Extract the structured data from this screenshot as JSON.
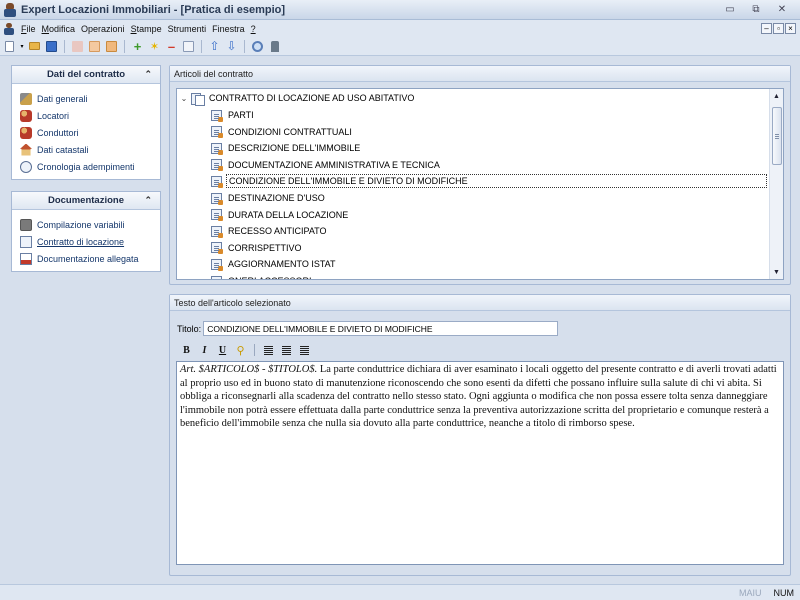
{
  "window": {
    "title": "Expert Locazioni Immobiliari - [Pratica di esempio]",
    "minimize": "▭",
    "restore": "⧉",
    "close": "✕"
  },
  "menu": [
    {
      "label": "File",
      "ul": "F",
      "rest": "ile"
    },
    {
      "label": "Modifica",
      "ul": "M",
      "rest": "odifica"
    },
    {
      "label": "Operazioni",
      "ul": "",
      "rest": "Operazioni"
    },
    {
      "label": "Stampe",
      "ul": "S",
      "rest": "tampe"
    },
    {
      "label": "Strumenti",
      "ul": "",
      "rest": "Strumenti"
    },
    {
      "label": "Finestra",
      "ul": "",
      "rest": "Finestra"
    },
    {
      "label": "?",
      "ul": "?",
      "rest": ""
    }
  ],
  "mdi": {
    "minimize": "–",
    "restore": "▫",
    "close": "×"
  },
  "toolbar": {
    "icons": [
      "new-document-icon",
      "dropdown-arrow-icon",
      "open-folder-icon",
      "save-icon",
      "cut-icon",
      "copy-icon",
      "paste-icon",
      "add-icon",
      "star-icon",
      "remove-icon",
      "duplicate-icon",
      "move-up-icon",
      "move-down-icon",
      "settings-icon",
      "print-icon"
    ],
    "colors": {
      "green": "#3f9a2c",
      "yellow": "#e5b400",
      "red": "#d23a2a",
      "blue": "#3a6fc9"
    }
  },
  "panel_contract": {
    "title": "Dati del contratto",
    "items": [
      {
        "label": "Dati generali",
        "icon": "tools-icon"
      },
      {
        "label": "Locatori",
        "icon": "people-icon"
      },
      {
        "label": "Conduttori",
        "icon": "people-icon"
      },
      {
        "label": "Dati catastali",
        "icon": "house-icon"
      },
      {
        "label": "Cronologia adempimenti",
        "icon": "clock-icon"
      }
    ]
  },
  "panel_docs": {
    "title": "Documentazione",
    "items": [
      {
        "label": "Compilazione variabili",
        "icon": "variables-icon"
      },
      {
        "label": "Contratto di locazione",
        "icon": "document-icon"
      },
      {
        "label": "Documentazione allegata",
        "icon": "attachment-icon"
      }
    ]
  },
  "articles": {
    "group_title": "Articoli del contratto",
    "root": "CONTRATTO DI LOCAZIONE AD USO ABITATIVO",
    "items": [
      "PARTI",
      "CONDIZIONI CONTRATTUALI",
      "DESCRIZIONE DELL'IMMOBILE",
      "DOCUMENTAZIONE AMMINISTRATIVA E TECNICA",
      "CONDIZIONE DELL'IMMOBILE E DIVIETO DI MODIFICHE",
      "DESTINAZIONE D'USO",
      "DURATA DELLA LOCAZIONE",
      "RECESSO ANTICIPATO",
      "CORRISPETTIVO",
      "AGGIORNAMENTO ISTAT",
      "ONERI ACCESSORI"
    ],
    "selected_index": 4
  },
  "article_text": {
    "group_title": "Testo dell'articolo selezionato",
    "title_label": "Titolo:",
    "title_value": "CONDIZIONE DELL'IMMOBILE E DIVIETO DI MODIFICHE",
    "format": {
      "bold": "B",
      "italic": "I",
      "underline": "U"
    },
    "prefix": "Art. $ARTICOLO$ - $TITOLO$.",
    "body": " La parte conduttrice dichiara di aver esaminato i locali oggetto del presente contratto e di averli trovati adatti al proprio uso ed in buono stato di manutenzione riconoscendo che sono esenti da difetti che possano influire sulla salute di chi vi abita. Si obbliga a riconsegnarli alla scadenza del contratto nello stesso stato. Ogni aggiunta o modifica che non possa essere tolta senza danneggiare l'immobile non potrà essere effettuata dalla parte conduttrice senza la preventiva autorizzazione scritta del proprietario e comunque resterà a beneficio dell'immobile senza che nulla sia dovuto alla parte conduttrice, neanche a titolo di rimborso spese."
  },
  "status": {
    "caps": "MAIU",
    "num": "NUM"
  }
}
